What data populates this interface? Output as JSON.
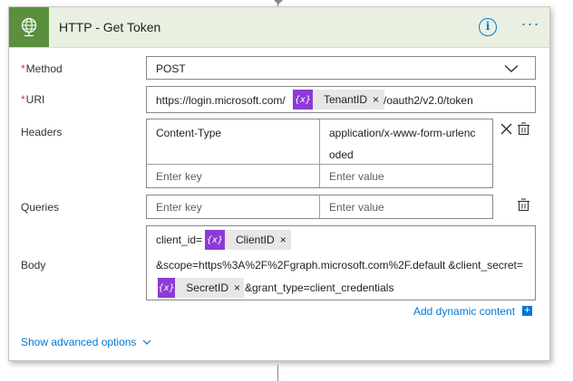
{
  "header": {
    "title": "HTTP - Get Token",
    "info_icon": "info-icon",
    "more_icon": "more-icon"
  },
  "method": {
    "label": "Method",
    "required": "*",
    "value": "POST"
  },
  "uri": {
    "label": "URI",
    "required": "*",
    "prefix": "https://login.microsoft.com/",
    "token_label": "TenantID",
    "suffix": "/oauth2/v2.0/token"
  },
  "headers": {
    "label": "Headers",
    "rows": [
      {
        "key": "Content-Type",
        "value_line1": "application/x-www-form-urlenc",
        "value_line2": "oded"
      }
    ],
    "key_placeholder": "Enter key",
    "value_placeholder": "Enter value"
  },
  "queries": {
    "label": "Queries",
    "key_placeholder": "Enter key",
    "value_placeholder": "Enter value"
  },
  "body": {
    "label": "Body",
    "line1_prefix": "client_id=",
    "token1_label": "ClientID",
    "line2": "&scope=https%3A%2F%2Fgraph.microsoft.com%2F.default &client_secret=",
    "token2_label": "SecretID",
    "line3_suffix": "&grant_type=client_credentials"
  },
  "token_symbol": "{x}",
  "token_close": "×",
  "add_dynamic_content": "Add dynamic content",
  "add_dynamic_plus": "+",
  "show_advanced": "Show advanced options",
  "colors": {
    "header_green": "#5a8f3e",
    "token_purple": "#8b3bd6",
    "link_blue": "#0078d4",
    "required_red": "#d13438"
  }
}
